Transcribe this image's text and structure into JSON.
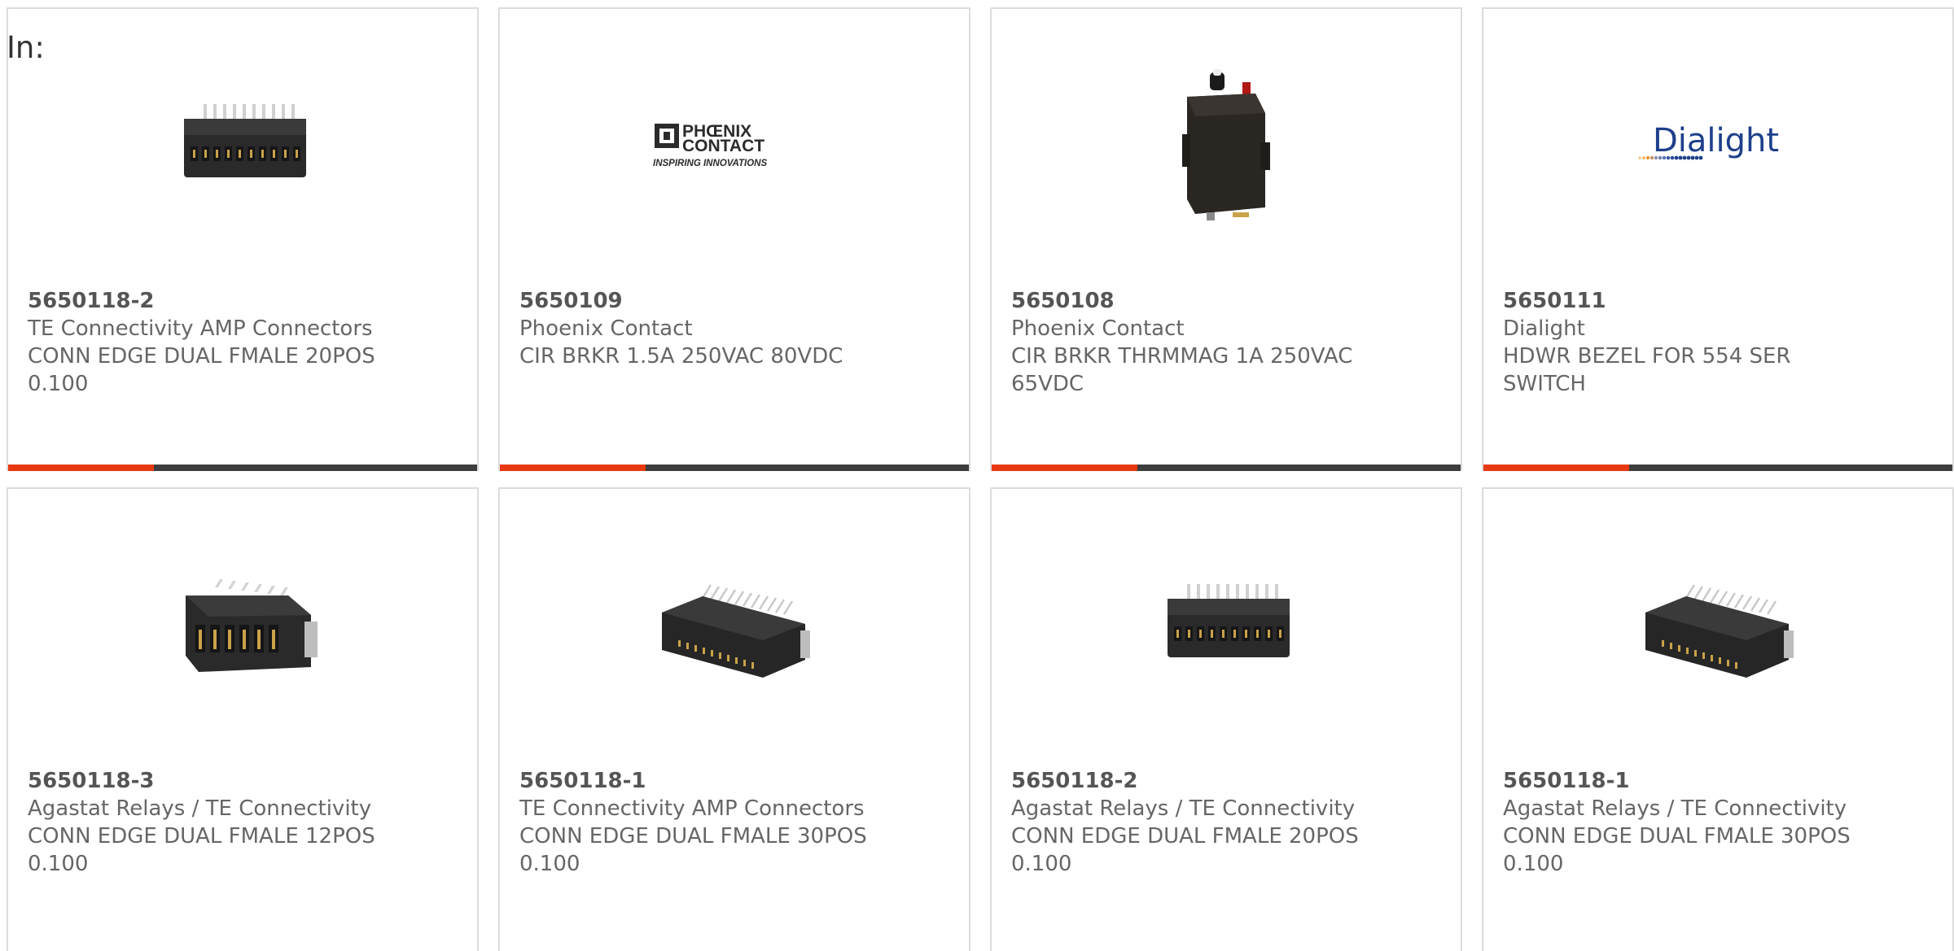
{
  "filter": {
    "label": "In:"
  },
  "colors": {
    "accent": "#e8380d",
    "bar": "#3d3d3d",
    "border": "#dcdcdc",
    "text": "#666666"
  },
  "products": [
    {
      "part": "5650118-2",
      "manufacturer": "TE Connectivity AMP Connectors",
      "desc_line1": "CONN EDGE DUAL FMALE 20POS",
      "desc_line2": "0.100",
      "image": "edge-connector-20pos-icon",
      "progress": 0.31
    },
    {
      "part": "5650109",
      "manufacturer": "Phoenix Contact",
      "desc_line1": "CIR BRKR 1.5A 250VAC 80VDC",
      "desc_line2": "",
      "image": "phoenix-contact-logo",
      "logo_text1": "PHŒNIX",
      "logo_text2": "CONTACT",
      "logo_tagline": "INSPIRING INNOVATIONS",
      "progress": 0.31
    },
    {
      "part": "5650108",
      "manufacturer": "Phoenix Contact",
      "desc_line1": "CIR BRKR THRMMAG 1A 250VAC",
      "desc_line2": "65VDC",
      "image": "circuit-breaker-icon",
      "progress": 0.31
    },
    {
      "part": "5650111",
      "manufacturer": "Dialight",
      "desc_line1": "HDWR BEZEL FOR 554 SER",
      "desc_line2": "SWITCH",
      "image": "dialight-logo",
      "logo_text": "Dialight",
      "progress": 0.31
    },
    {
      "part": "5650118-3",
      "manufacturer": "Agastat Relays / TE Connectivity",
      "desc_line1": "CONN EDGE DUAL FMALE 12POS",
      "desc_line2": "0.100",
      "image": "edge-connector-12pos-icon"
    },
    {
      "part": "5650118-1",
      "manufacturer": "TE Connectivity AMP Connectors",
      "desc_line1": "CONN EDGE DUAL FMALE 30POS",
      "desc_line2": "0.100",
      "image": "edge-connector-30pos-icon"
    },
    {
      "part": "5650118-2",
      "manufacturer": "Agastat Relays / TE Connectivity",
      "desc_line1": "CONN EDGE DUAL FMALE 20POS",
      "desc_line2": "0.100",
      "image": "edge-connector-20pos-icon"
    },
    {
      "part": "5650118-1",
      "manufacturer": "Agastat Relays / TE Connectivity",
      "desc_line1": "CONN EDGE DUAL FMALE 30POS",
      "desc_line2": "0.100",
      "image": "edge-connector-30pos-icon"
    }
  ]
}
